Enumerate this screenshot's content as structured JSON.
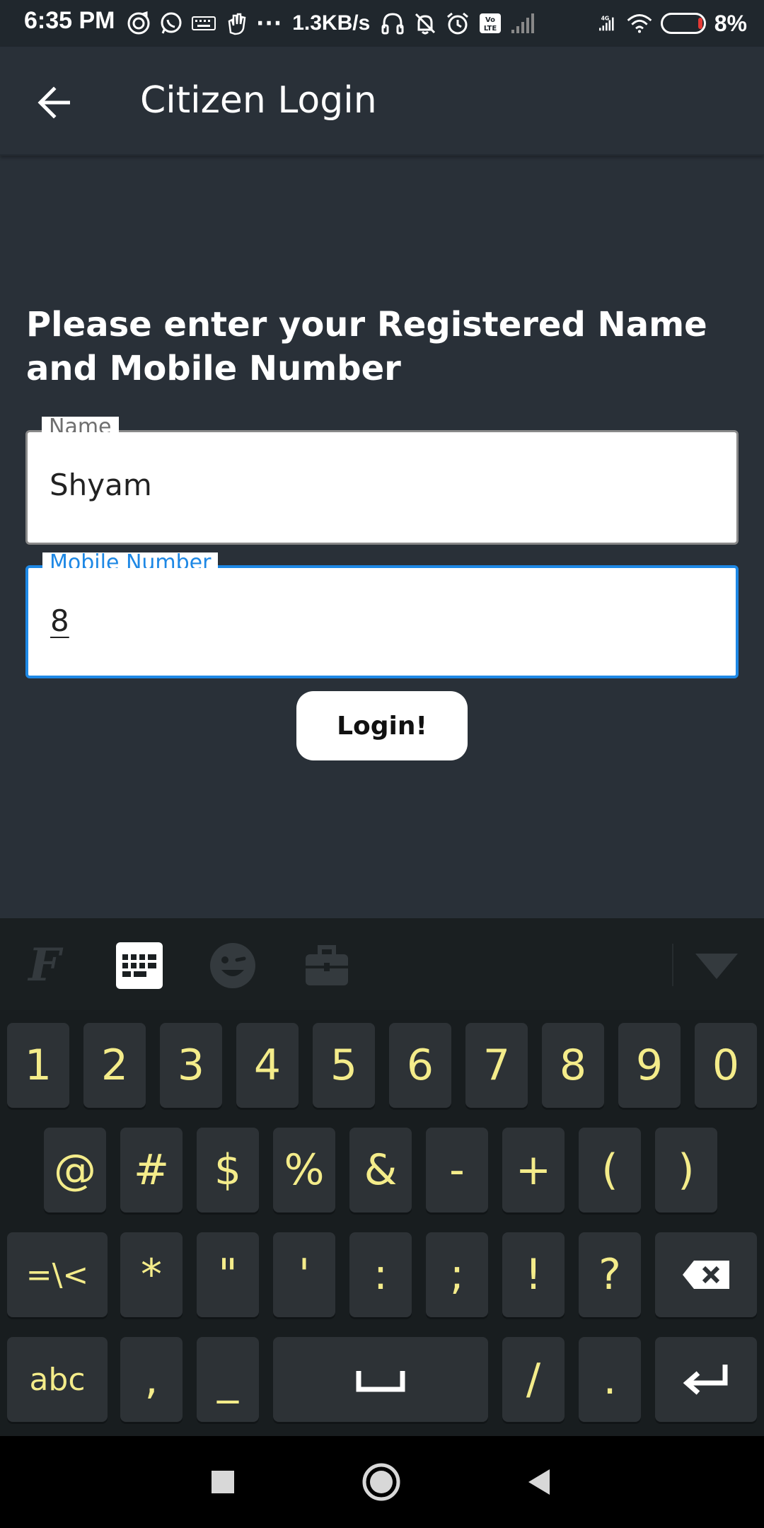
{
  "status_bar": {
    "time": "6:35 PM",
    "network_speed": "1.3KB/s",
    "battery_percent": "8%",
    "icons": [
      "music-app-icon",
      "whatsapp-icon",
      "keyboard-icon",
      "hand-icon",
      "more-dots-icon",
      "headphones-icon",
      "mute-bell-icon",
      "alarm-icon",
      "volte-icon",
      "signal-icon",
      "4g-signal-icon",
      "wifi-icon",
      "battery-icon"
    ]
  },
  "app_bar": {
    "title": "Citizen Login"
  },
  "form": {
    "prompt": "Please enter your Registered Name and Mobile Number",
    "name_label": "Name",
    "name_value": "Shyam",
    "mobile_label": "Mobile Number",
    "mobile_value": "8",
    "login_label": "Login!"
  },
  "keyboard": {
    "toolbar": [
      "font-icon",
      "keyboard-layout-icon",
      "emoji-icon",
      "toolbox-icon",
      "collapse-icon"
    ],
    "row1": [
      "1",
      "2",
      "3",
      "4",
      "5",
      "6",
      "7",
      "8",
      "9",
      "0"
    ],
    "row2": [
      "@",
      "#",
      "$",
      "%",
      "&",
      "-",
      "+",
      "(",
      ")"
    ],
    "row3": [
      "=\\<",
      "*",
      "\"",
      "'",
      ":",
      ";",
      "!",
      "?"
    ],
    "row4": [
      "abc",
      ",",
      "_",
      "/",
      "."
    ],
    "key_color": "#f4ec8a"
  },
  "nav_bar": {
    "buttons": [
      "recents",
      "home",
      "back"
    ]
  }
}
